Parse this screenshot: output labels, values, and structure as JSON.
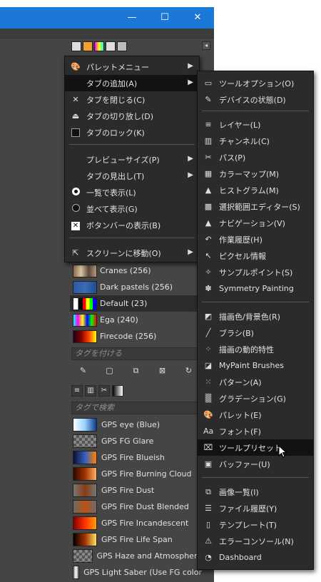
{
  "window": {
    "minimize": "—",
    "maximize": "☐",
    "close": "✕"
  },
  "colors": {
    "titlebar": "#1b78d6",
    "menu_bg": "#2b2b2b",
    "highlight": "#121212"
  },
  "left_menu": {
    "items": [
      {
        "icon": "palette-icon",
        "glyph": "🎨",
        "label": "パレットメニュー",
        "submenu": true
      },
      {
        "icon": "none",
        "glyph": "",
        "label": "タブの追加(A)",
        "submenu": true,
        "highlighted": true
      },
      {
        "icon": "close-icon",
        "glyph": "✕",
        "label": "タブを閉じる(C)"
      },
      {
        "icon": "eject-icon",
        "glyph": "⏏",
        "label": "タブの切り放し(D)"
      },
      {
        "icon": "lock-square-icon",
        "glyph": "",
        "label": "タブのロック(K)"
      },
      {
        "icon": "none",
        "glyph": "",
        "label": "プレビューサイズ(P)",
        "submenu": true
      },
      {
        "icon": "none",
        "glyph": "",
        "label": "タブの見出し(T)",
        "submenu": true
      },
      {
        "icon": "radio-selected-icon",
        "glyph": "",
        "label": "一覧で表示(L)"
      },
      {
        "icon": "radio-icon",
        "glyph": "",
        "label": "並べて表示(G)"
      },
      {
        "icon": "checkbox-checked-icon",
        "glyph": "✕",
        "label": "ボタンバーの表示(B)"
      },
      {
        "icon": "screen-move-icon",
        "glyph": "⇱",
        "label": "スクリーンに移動(O)",
        "submenu": true
      }
    ]
  },
  "right_menu": {
    "items": [
      {
        "icon": "tool-options-icon",
        "glyph": "▭",
        "label": "ツールオプション(O)"
      },
      {
        "icon": "device-status-icon",
        "glyph": "✎",
        "label": "デバイスの状態(D)"
      },
      {
        "icon": "layers-icon",
        "glyph": "≡",
        "label": "レイヤー(L)"
      },
      {
        "icon": "channels-icon",
        "glyph": "▥",
        "label": "チャンネル(C)"
      },
      {
        "icon": "paths-icon",
        "glyph": "✂",
        "label": "パス(P)"
      },
      {
        "icon": "colormap-icon",
        "glyph": "▦",
        "label": "カラーマップ(M)"
      },
      {
        "icon": "histogram-icon",
        "glyph": "▲",
        "label": "ヒストグラム(M)"
      },
      {
        "icon": "selection-editor-icon",
        "glyph": "▩",
        "label": "選択範囲エディター(S)"
      },
      {
        "icon": "navigation-icon",
        "glyph": "▲",
        "label": "ナビゲーション(V)"
      },
      {
        "icon": "undo-history-icon",
        "glyph": "↶",
        "label": "作業履歴(H)"
      },
      {
        "icon": "pointer-info-icon",
        "glyph": "↖",
        "label": "ピクセル情報"
      },
      {
        "icon": "sample-points-icon",
        "glyph": "✧",
        "label": "サンプルポイント(S)"
      },
      {
        "icon": "symmetry-icon",
        "glyph": "✽",
        "label": "Symmetry Painting"
      },
      {
        "icon": "fg-bg-color-icon",
        "glyph": "◩",
        "label": "描画色/背景色(R)"
      },
      {
        "icon": "brushes-icon",
        "glyph": "╱",
        "label": "ブラシ(B)"
      },
      {
        "icon": "paint-dynamics-icon",
        "glyph": "⁘",
        "label": "描画の動的特性"
      },
      {
        "icon": "mypaint-brushes-icon",
        "glyph": "◪",
        "label": "MyPaint Brushes"
      },
      {
        "icon": "patterns-icon",
        "glyph": "⁙",
        "label": "パターン(A)"
      },
      {
        "icon": "gradients-icon",
        "glyph": "▒",
        "label": "グラデーション(G)"
      },
      {
        "icon": "palettes-icon",
        "glyph": "🎨",
        "label": "パレット(E)"
      },
      {
        "icon": "fonts-icon",
        "glyph": "Aa",
        "label": "フォント(F)"
      },
      {
        "icon": "tool-presets-icon",
        "glyph": "⌧",
        "label": "ツールプリセット",
        "highlighted": true
      },
      {
        "icon": "buffers-icon",
        "glyph": "▣",
        "label": "バッファー(U)"
      },
      {
        "icon": "images-icon",
        "glyph": "⧉",
        "label": "画像一覧(I)"
      },
      {
        "icon": "document-history-icon",
        "glyph": "☰",
        "label": "ファイル履歴(Y)"
      },
      {
        "icon": "templates-icon",
        "glyph": "▯",
        "label": "テンプレート(T)"
      },
      {
        "icon": "error-console-icon",
        "glyph": "⚠",
        "label": "エラーコンソール(N)"
      },
      {
        "icon": "dashboard-icon",
        "glyph": "◔",
        "label": "Dashboard"
      }
    ]
  },
  "palettes": [
    {
      "label": "Cranes (256)",
      "swatch": "linear-gradient(90deg,#8c6b4a,#d8c6a0,#5a4a3a,#b59b7c)"
    },
    {
      "label": "Dark pastels (256)",
      "swatch": "linear-gradient(90deg,#2a5aa0,#3b6bb5,#1f4f8f)"
    },
    {
      "label": "Default (23)",
      "swatch": "linear-gradient(90deg,#ffffff 0 20%,#000 20% 40%,#ff0000 40% 55%,#ffff00 55% 70%,#00ff00 70% 85%,#0000ff 85%)",
      "selected": true
    },
    {
      "label": "Ega (240)",
      "swatch": "linear-gradient(90deg,#00ffff,#ff00ff,#ffff00,#0000ff,#00ff00,#ff0000)"
    },
    {
      "label": "Firecode (256)",
      "swatch": "linear-gradient(90deg,#200020,#800000,#ff4000,#ffff00)"
    }
  ],
  "palette_tag_placeholder": "タグを付ける",
  "gradient_search_placeholder": "タグで検索",
  "gradients": [
    {
      "label": "GPS eye (Blue)",
      "swatch": "linear-gradient(90deg,#ffffff,#9ad0ff,#0a3a8a)"
    },
    {
      "label": "GPS FG Glare",
      "swatch": "checker"
    },
    {
      "label": "GPS Fire Blueish",
      "swatch": "linear-gradient(90deg,#0a1030,#3060c0,#ff8000)"
    },
    {
      "label": "GPS Fire Burning Cloud",
      "swatch": "linear-gradient(90deg,#2a0a00,#a03000,#ffb060)"
    },
    {
      "label": "GPS Fire Dust",
      "swatch": "linear-gradient(90deg,#777,#8a3a10,#777)"
    },
    {
      "label": "GPS Fire Dust Blended",
      "swatch": "linear-gradient(90deg,#6a6a6a,#c05010,#6a6a6a)"
    },
    {
      "label": "GPS Fire Incandescent",
      "swatch": "linear-gradient(90deg,#800000,#ff3000,#ffa000)"
    },
    {
      "label": "GPS Fire Life Span",
      "swatch": "linear-gradient(90deg,#000,#a03000,#ffe060)"
    },
    {
      "label": "GPS Haze and Atmosphere",
      "swatch": "checker"
    },
    {
      "label": "GPS Light Saber (Use FG color",
      "swatch": "linear-gradient(90deg,#777,#fff,#777)"
    }
  ]
}
